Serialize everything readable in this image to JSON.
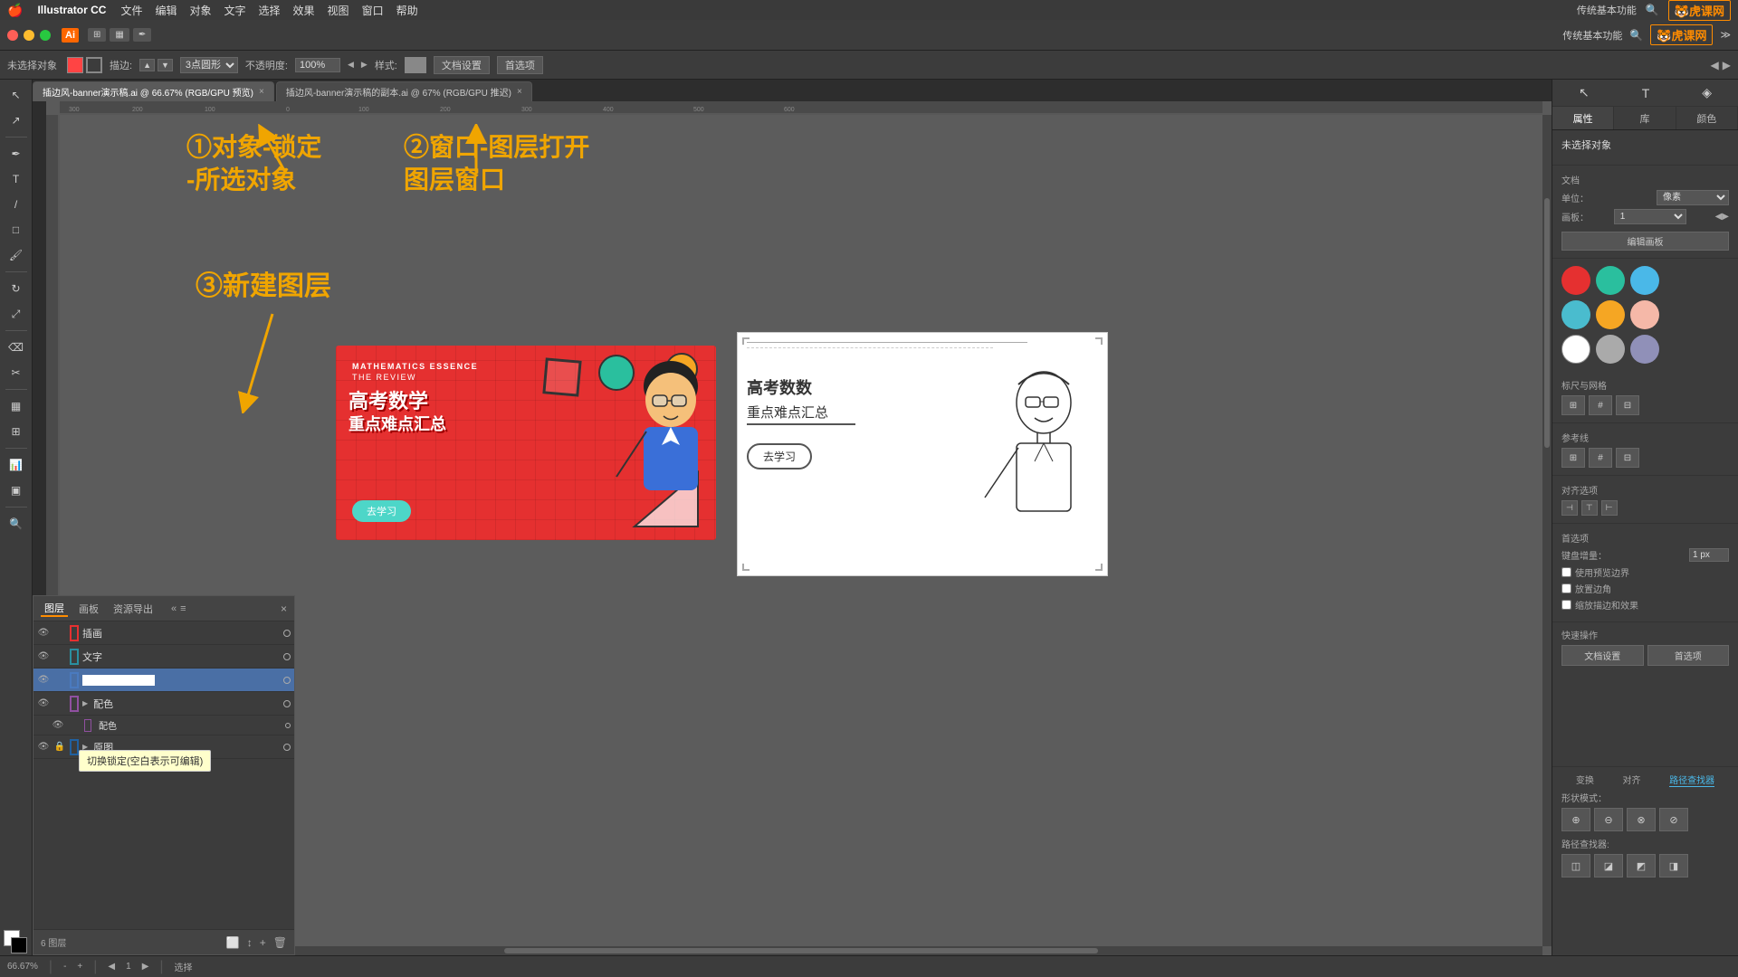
{
  "app": {
    "name": "Illustrator CC",
    "logo": "Ai",
    "zoom": "66.67%",
    "color_mode": "RGB/GPU 预览"
  },
  "menu": {
    "apple": "🍎",
    "items": [
      "Illustrator CC",
      "文件",
      "编辑",
      "对象",
      "文字",
      "选择",
      "效果",
      "视图",
      "窗口",
      "帮助"
    ]
  },
  "toolbar": {
    "no_selection": "未选择对象",
    "stroke": "描边:",
    "opacity_label": "不透明度:",
    "opacity_value": "100%",
    "style_label": "样式:",
    "doc_settings": "文档设置",
    "preferences": "首选项"
  },
  "tabs": [
    {
      "label": "插边风-banner演示稿.ai @ 66.67% (RGB/GPU 预览)",
      "active": true
    },
    {
      "label": "插边风-banner演示稿的副本.ai @ 67% (RGB/GPU 推迟)",
      "active": false
    }
  ],
  "annotations": {
    "step1": "①对象-锁定\n-所选对象",
    "step2": "②窗口-图层打开\n图层窗口",
    "step3": "③新建图层"
  },
  "right_panel": {
    "tabs": [
      "属性",
      "库",
      "颜色"
    ],
    "active_tab": "属性",
    "no_selection": "未选择对象",
    "document_label": "文档",
    "unit_label": "单位：",
    "unit_value": "像素",
    "artboard_label": "画板：",
    "artboard_value": "1",
    "edit_artboard_btn": "编辑画板",
    "rulers_label": "标尺与网格",
    "guides_label": "参考线",
    "align_label": "对齐选项",
    "prefs_label": "首选项",
    "keyboard_increment_label": "键盘增量：",
    "keyboard_increment_value": "1 px",
    "use_preview_bounds": "使用预览边界",
    "round_corners": "放置边角",
    "scale_strokes": "缩放描边和效果",
    "quick_actions_label": "快速操作",
    "doc_settings_btn": "文档设置",
    "prefs_btn": "首选项"
  },
  "colors": [
    {
      "name": "red",
      "value": "#e53030"
    },
    {
      "name": "teal",
      "value": "#2abf9e"
    },
    {
      "name": "blue",
      "value": "#4ab8e8"
    },
    {
      "name": "cyan",
      "value": "#4abcce"
    },
    {
      "name": "orange",
      "value": "#f5a623"
    },
    {
      "name": "pink",
      "value": "#f5b8a8"
    },
    {
      "name": "white",
      "value": "#ffffff"
    },
    {
      "name": "gray",
      "value": "#aaaaaa"
    },
    {
      "name": "purple-gray",
      "value": "#9090b8"
    }
  ],
  "layers_panel": {
    "tabs": [
      "图层",
      "画板",
      "资源导出"
    ],
    "active_tab": "图层",
    "layers": [
      {
        "name": "插画",
        "visible": true,
        "locked": false,
        "color": "#e53030",
        "expanded": false
      },
      {
        "name": "文字",
        "visible": true,
        "locked": false,
        "color": "#2a8fa0",
        "expanded": false
      },
      {
        "name": "",
        "visible": true,
        "locked": false,
        "color": "#4a7abf",
        "editing": true,
        "expanded": false
      },
      {
        "name": "配色",
        "visible": true,
        "locked": false,
        "color": "#9050a0",
        "expanded": true
      },
      {
        "name": "原图",
        "visible": true,
        "locked": true,
        "color": "#2060a0",
        "expanded": false
      }
    ],
    "layer_count": "6 图层",
    "tooltip": "切换锁定(空白表示可编辑)"
  },
  "banner": {
    "top_text1": "MATHEMATICS ESSENCE",
    "top_text2": "THE REVIEW",
    "main_text1": "高考数学",
    "main_text2": "重点难点汇总",
    "button_text": "去学习",
    "bg_color": "#e53030"
  },
  "sketch_doc": {
    "main_text1": "高考数数",
    "main_text2": "重点难点汇总",
    "button_text": "去学习"
  },
  "status_bar": {
    "zoom": "66.67%",
    "zoom_label": "66.67%",
    "tool_label": "选择",
    "artboard_num": "1"
  },
  "path_finder": {
    "label": "路径查找器",
    "shape_mode_label": "形状模式：",
    "path_finder_label": "路径查找器:",
    "keyboard_increment": "1 px"
  }
}
